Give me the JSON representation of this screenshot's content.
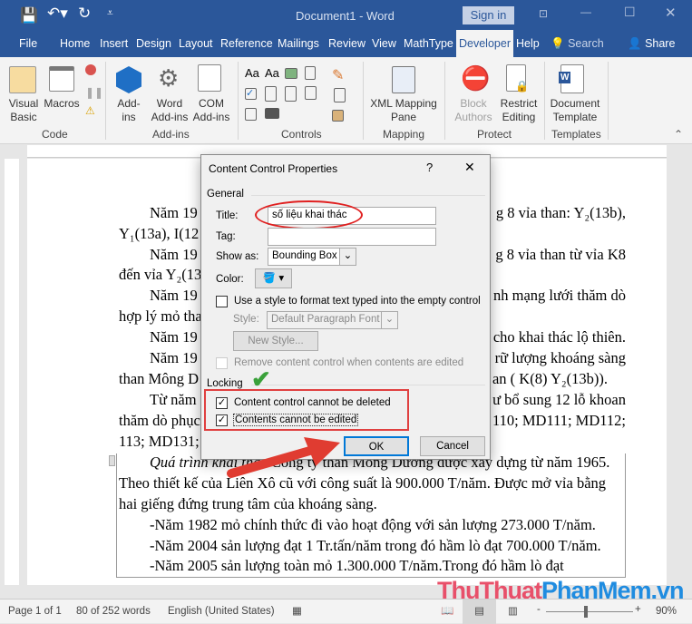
{
  "titlebar": {
    "title": "Document1  -  Word",
    "sign_in": "Sign in"
  },
  "tabs": [
    "File",
    "Home",
    "Insert",
    "Design",
    "Layout",
    "Reference",
    "Mailings",
    "Review",
    "View",
    "MathType",
    "Developer",
    "Help"
  ],
  "search": "Search",
  "share": "Share",
  "ribbon": {
    "code": {
      "label": "Code",
      "visual_basic": [
        "Visual",
        "Basic"
      ],
      "macros": "Macros"
    },
    "addins": {
      "label": "Add-ins",
      "addins": [
        "Add-",
        "ins"
      ],
      "word_addins": [
        "Word",
        "Add-ins"
      ],
      "com_addins": [
        "COM",
        "Add-ins"
      ]
    },
    "controls": {
      "label": "Controls"
    },
    "mapping": {
      "label": "Mapping",
      "xml": [
        "XML Mapping",
        "Pane"
      ]
    },
    "protect": {
      "label": "Protect",
      "block": [
        "Block",
        "Authors"
      ],
      "restrict": [
        "Restrict",
        "Editing"
      ]
    },
    "templates": {
      "label": "Templates",
      "doc": [
        "Document",
        "Template"
      ]
    }
  },
  "document": {
    "left": [
      "Năm 19",
      "Y₁(13a), I(12",
      "Năm 19",
      "đến vỉa Y₂(13",
      "Năm 19",
      "hợp lý mỏ tha",
      "Năm 19",
      "Năm 19",
      "than Mông D",
      "Từ năm",
      "thăm dò phục",
      "113; MD131;"
    ],
    "right": [
      "g 8 vỉa than: Y₂(13b),",
      "g 8 vỉa than từ vỉa K8",
      "nh mạng lưới thăm dò",
      "cho khai thác lộ thiên.",
      "rữ  lượng khoáng sàng",
      "an ( K(8)  Y₂(13b)).",
      "ư bổ sung 12 lỗ khoan",
      "110; MD111; MD112;"
    ],
    "box_italic": "Quá trình khai thác",
    "box": [
      " Công ty than Mông Dương được xây dựng từ  năm 1965.",
      "Theo thiết kế của Liên Xô cũ với công suất là 900.000 T/năm. Được mở vỉa bằng",
      "hai giếng đứng trung tâm của khoáng sàng.",
      "-Năm 1982 mỏ chính thức đi vào hoạt động với sản lượng 273.000 T/năm.",
      "-Năm 2004 sản lượng đạt 1 Tr.tấn/năm trong đó hầm lò đạt  700.000 T/năm.",
      "-Năm 2005 sản lượng toàn mỏ 1.300.000 T/năm.Trong đó hầm lò đạt"
    ]
  },
  "dialog": {
    "title": "Content Control Properties",
    "help": "?",
    "close": "✕",
    "general": "General",
    "title_label": "Title:",
    "title_value": "số liệu khai thác",
    "tag_label": "Tag:",
    "tag_value": "",
    "show_as_label": "Show as:",
    "show_as_value": "Bounding Box",
    "color_label": "Color:",
    "use_style": "Use a style to format text typed into the empty control",
    "style_label": "Style:",
    "style_value": "Default Paragraph Font",
    "new_style": "New Style...",
    "remove": "Remove content control when contents are edited",
    "locking": "Locking",
    "cannot_delete": "Content control cannot be deleted",
    "cannot_edit": "Contents cannot be edited",
    "ok": "OK",
    "cancel": "Cancel"
  },
  "status": {
    "page": "Page 1 of 1",
    "words": "80 of 252 words",
    "language": "English (United States)",
    "zoom_minus": "-",
    "zoom_plus": "+",
    "zoom": "90%"
  },
  "watermark": {
    "part1": "ThuThuat",
    "part2": "PhanMem",
    "part3": ".vn"
  },
  "colors": {
    "brand": "#2b579a",
    "highlight": "#e03c31",
    "check": "#3aa13a"
  }
}
